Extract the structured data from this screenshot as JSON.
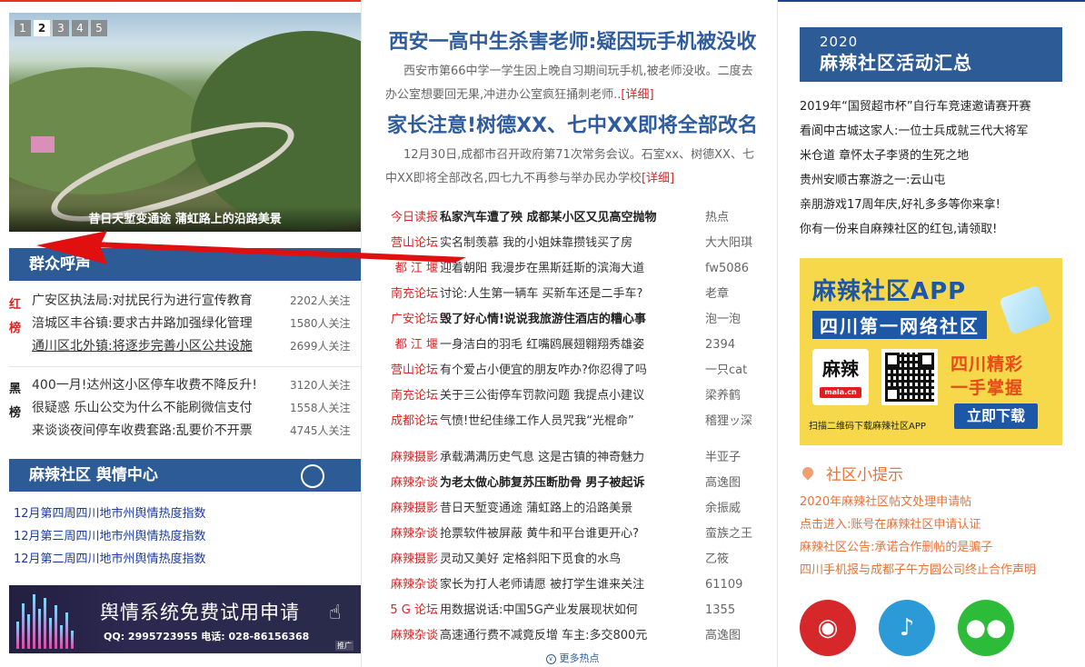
{
  "slider": {
    "pages": [
      "1",
      "2",
      "3",
      "4",
      "5"
    ],
    "active_page": "2",
    "caption": "昔日天堑变通途 蒲虹路上的沿路美景"
  },
  "qunzhong": {
    "title": "群众呼声",
    "red_label": [
      "红",
      "榜"
    ],
    "black_label": [
      "黑",
      "榜"
    ],
    "red_list": [
      {
        "title": "广安区执法局:对扰民行为进行宣传教育",
        "count": "2202人关注"
      },
      {
        "title": "涪城区丰谷镇:要求古井路加强绿化管理",
        "count": "1580人关注"
      },
      {
        "title": "通川区北外镇:将逐步完善小区公共设施",
        "count": "2699人关注"
      }
    ],
    "black_list": [
      {
        "title": "400一月!达州这小区停车收费不降反升!",
        "count": "3120人关注"
      },
      {
        "title": "很疑惑 乐山公交为什么不能刷微信支付",
        "count": "1558人关注"
      },
      {
        "title": "来谈谈夜间停车收费套路:乱要价不开票",
        "count": "4745人关注"
      }
    ]
  },
  "yuqing": {
    "title": "麻辣社区 舆情中心",
    "links": [
      "12月第四周四川地市州舆情热度指数",
      "12月第三周四川地市州舆情热度指数",
      "12月第二周四川地市州舆情热度指数"
    ],
    "banner_title": "舆情系统免费试用申请",
    "banner_sub": "QQ: 2995723955  电话: 028-86156368",
    "banner_tag": "推广"
  },
  "headlines": [
    {
      "title": "西安一高中生杀害老师:疑因玩手机被没收",
      "summary": "西安市第66中学一学生因上晚自习期间玩手机,被老师没收。二度去办公室想要回无果,冲进办公室疯狂捅刺老师..",
      "more": "[详细]"
    },
    {
      "title": "家长注意!树德XX、七中XX即将全部改名",
      "summary": "12月30日,成都市召开政府第71次常务会议。石室xx、树德XX、七中XX即将全部改名,四七九不再参与举办民办学校",
      "more": "[详细]"
    }
  ],
  "list_group1": [
    {
      "cat": "今日读报",
      "title": "私家汽车遭了殃 成都某小区又见高空抛物",
      "author": "热点",
      "bold": true
    },
    {
      "cat": "营山论坛",
      "title": "实名制羡慕 我的小姐妹靠攒钱买了房",
      "author": "大大阳琪",
      "bold": false
    },
    {
      "cat": "都 江 堰",
      "title": "迎着朝阳 我漫步在黑斯廷斯的滨海大道",
      "author": "fw5086",
      "bold": false
    },
    {
      "cat": "南充论坛",
      "title": "讨论:人生第一辆车 买新车还是二手车?",
      "author": "老章",
      "bold": false
    },
    {
      "cat": "广安论坛",
      "title": "毁了好心情!说说我旅游住酒店的糟心事",
      "author": "泡一泡",
      "bold": true
    },
    {
      "cat": "都 江 堰",
      "title": "一身洁白的羽毛 红嘴鸥展翅翱翔秀雄姿",
      "author": "2394",
      "bold": false
    },
    {
      "cat": "营山论坛",
      "title": "有个爱占小便宜的朋友咋办?你忍得了吗",
      "author": "一只cat",
      "bold": false
    },
    {
      "cat": "南充论坛",
      "title": "关于三公街停车罚款问题 我提点小建议",
      "author": "梁养鹤",
      "bold": false
    },
    {
      "cat": "成都论坛",
      "title": "气愤!世纪佳缘工作人员咒我“光棍命”",
      "author": "稽狸ッ深",
      "bold": false
    }
  ],
  "list_group2": [
    {
      "cat": "麻辣摄影",
      "title": "承载满满历史气息 这是古镇的神奇魅力",
      "author": "半亚子",
      "bold": false
    },
    {
      "cat": "麻辣杂谈",
      "title": "为老太做心肺复苏压断肋骨 男子被起诉",
      "author": "高逸图",
      "bold": true
    },
    {
      "cat": "麻辣摄影",
      "title": "昔日天堑变通途 蒲虹路上的沿路美景",
      "author": "余振威",
      "bold": false
    },
    {
      "cat": "麻辣杂谈",
      "title": "抢票软件被屏蔽 黄牛和平台谁更开心?",
      "author": "蛮族之王",
      "bold": false
    },
    {
      "cat": "麻辣摄影",
      "title": "灵动又美好 定格斜阳下觅食的水鸟",
      "author": "乙筱",
      "bold": false
    },
    {
      "cat": "麻辣杂谈",
      "title": "家长为打人老师请愿 被打学生谁来关注",
      "author": "61109",
      "bold": false
    },
    {
      "cat": "5 G 论坛",
      "title": "用数据说话:中国5G产业发展现状如何",
      "author": "1355",
      "bold": false
    },
    {
      "cat": "麻辣杂谈",
      "title": "高速通行费不减竟反增 车主:多交800元",
      "author": "高逸图",
      "bold": false
    }
  ],
  "more_hot": "更多热点",
  "activity": {
    "year": "2020",
    "title": "麻辣社区活动汇总",
    "items": [
      "2019年“国贸超市杯”自行车竞速邀请赛开赛",
      "看阆中古城这家人:一位士兵成就三代大将军",
      "米仓道 章怀太子李贤的生死之地",
      "贵州安顺古寨游之一:云山屯",
      "亲朋游戏17周年庆,好礼多多等你来拿!",
      "你有一份来自麻辣社区的红包,请领取!"
    ]
  },
  "app_ad": {
    "line1": "麻辣社区APP",
    "line2": "四川第一网络社区",
    "logo": "麻辣",
    "logo_sub": "mala.cn",
    "slogan1": "四川精彩",
    "slogan2": "一手掌握",
    "download": "立即下载",
    "scan": "扫描二维码下载麻辣社区APP"
  },
  "tips": {
    "title": "社区小提示",
    "items": [
      "2020年麻辣社区帖文处理申请帖",
      "点击进入:账号在麻辣社区申请认证",
      "麻辣社区公告:承诺合作删帖的是骗子",
      "四川手机报与成都子午方圆公司终止合作声明"
    ]
  },
  "colors": {
    "brand_blue": "#2c5b95",
    "accent_red": "#d92424",
    "tip_orange": "#e8723a",
    "arrow_red": "#e01010"
  }
}
